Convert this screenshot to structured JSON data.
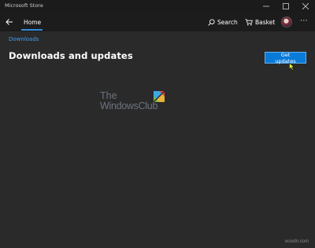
{
  "window": {
    "title": "Microsoft Store"
  },
  "nav": {
    "home_label": "Home",
    "search_label": "Search",
    "basket_label": "Basket"
  },
  "breadcrumb": "Downloads",
  "page": {
    "title": "Downloads and updates",
    "get_updates_label": "Get updates"
  },
  "watermark": {
    "line1": "The",
    "line2": "WindowsClub"
  },
  "footer": {
    "mark": "wsxdn.com"
  },
  "colors": {
    "accent": "#0a7ad8",
    "link": "#3ea0f5",
    "background": "#2a2a2a"
  },
  "icons": [
    "minimize-icon",
    "maximize-icon",
    "close-icon",
    "back-arrow-icon",
    "search-icon",
    "basket-icon",
    "more-icon",
    "cursor-icon",
    "windows-club-logo"
  ]
}
